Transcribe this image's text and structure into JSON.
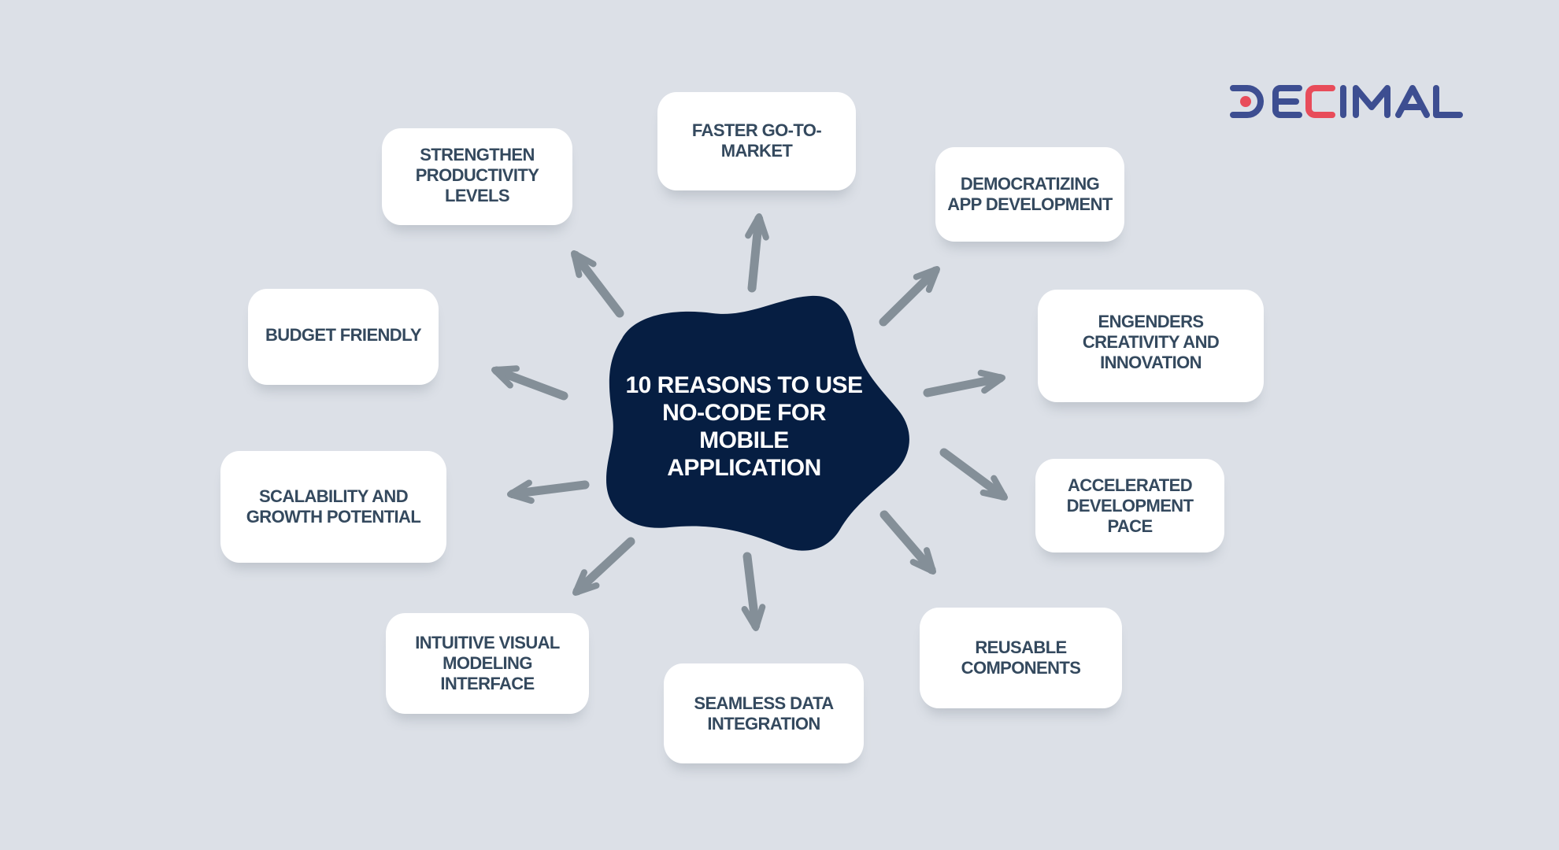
{
  "title": "10 REASONS TO USE\nNO-CODE FOR\nMOBILE\nAPPLICATION",
  "brand": {
    "name": "DECIMAL",
    "primary_color": "#3d4e91",
    "accent_color": "#e84c5a"
  },
  "colors": {
    "background": "#dce0e7",
    "center_blob": "#061e42",
    "card": "#ffffff",
    "card_text": "#34495e",
    "arrow": "#848f98"
  },
  "reasons": [
    {
      "id": "faster-go-to-market",
      "label": "FASTER GO-TO-\nMARKET"
    },
    {
      "id": "democratizing-app-development",
      "label": "DEMOCRATIZING\nAPP DEVELOPMENT"
    },
    {
      "id": "engenders-creativity",
      "label": "ENGENDERS\nCREATIVITY AND\nINNOVATION"
    },
    {
      "id": "accelerated-development-pace",
      "label": "ACCELERATED\nDEVELOPMENT\nPACE"
    },
    {
      "id": "reusable-components",
      "label": "REUSABLE\nCOMPONENTS"
    },
    {
      "id": "seamless-data-integration",
      "label": "SEAMLESS DATA\nINTEGRATION"
    },
    {
      "id": "intuitive-visual-modeling",
      "label": "INTUITIVE VISUAL\nMODELING\nINTERFACE"
    },
    {
      "id": "scalability-growth",
      "label": "SCALABILITY AND\nGROWTH POTENTIAL"
    },
    {
      "id": "budget-friendly",
      "label": "BUDGET FRIENDLY"
    },
    {
      "id": "strengthen-productivity",
      "label": "STRENGTHEN\nPRODUCTIVITY\nLEVELS"
    }
  ]
}
